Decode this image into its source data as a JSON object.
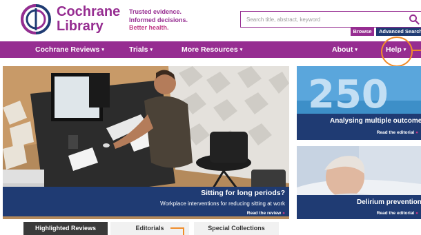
{
  "colors": {
    "brand_purple": "#962d91",
    "accent_pink": "#c13b88",
    "navy": "#1f3b73",
    "annotation_orange": "#f08c2a"
  },
  "brand": {
    "name_line1": "Cochrane",
    "name_line2": "Library",
    "logo_icon": "cochrane-logo-icon"
  },
  "tagline": {
    "line1": "Trusted evidence.",
    "line2": "Informed decisions.",
    "line3": "Better health."
  },
  "search": {
    "placeholder": "Search title, abstract, keyword",
    "value": "",
    "icon": "search-icon",
    "browse_label": "Browse",
    "advanced_label": "Advanced Search"
  },
  "nav": {
    "items": [
      {
        "label": "Cochrane Reviews",
        "caret": "▾"
      },
      {
        "label": "Trials",
        "caret": "▾"
      },
      {
        "label": "More Resources",
        "caret": "▾"
      },
      {
        "label": "About",
        "caret": "▾"
      },
      {
        "label": "Help",
        "caret": "▾"
      }
    ]
  },
  "hero": {
    "title": "Sitting for long periods?",
    "subtitle": "Workplace interventions for reducing sitting at work",
    "read_label": "Read the review",
    "read_dot": "●"
  },
  "side_cards": [
    {
      "title": "Analysing multiple outcomes",
      "read_label": "Read the editorial",
      "read_dot": "●",
      "image_text": "250"
    },
    {
      "title": "Delirium prevention",
      "read_label": "Read the editorial",
      "read_dot": "●"
    }
  ],
  "tabs": [
    {
      "label": "Highlighted Reviews",
      "active": true
    },
    {
      "label": "Editorials",
      "active": false
    },
    {
      "label": "Special Collections",
      "active": false
    }
  ]
}
